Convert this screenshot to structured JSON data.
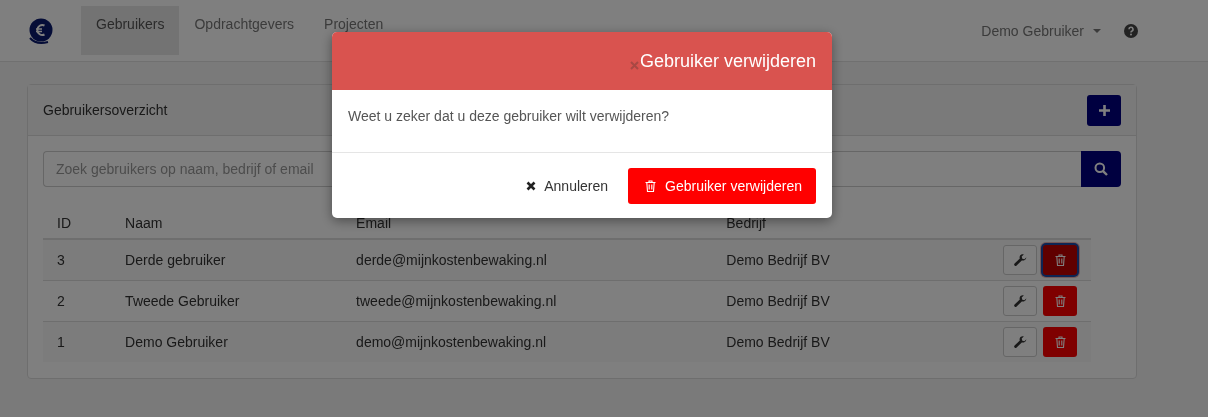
{
  "navbar": {
    "items": [
      {
        "label": "Gebruikers",
        "selected": true
      },
      {
        "label": "Opdrachtgevers",
        "selected": false
      },
      {
        "label": "Projecten",
        "selected": false
      }
    ],
    "user_menu": "Demo Gebruiker"
  },
  "panel": {
    "title": "Gebruikersoverzicht",
    "search": {
      "placeholder": "Zoek gebruikers op naam, bedrijf of email"
    },
    "table": {
      "columns": [
        "ID",
        "Naam",
        "Email",
        "Bedrijf"
      ],
      "rows": [
        {
          "id": "3",
          "name": "Derde gebruiker",
          "email": "derde@mijnkostenbewaking.nl",
          "company": "Demo Bedrijf BV",
          "delete_focused": true
        },
        {
          "id": "2",
          "name": "Tweede Gebruiker",
          "email": "tweede@mijnkostenbewaking.nl",
          "company": "Demo Bedrijf BV",
          "delete_focused": false
        },
        {
          "id": "1",
          "name": "Demo Gebruiker",
          "email": "demo@mijnkostenbewaking.nl",
          "company": "Demo Bedrijf BV",
          "delete_focused": false
        }
      ]
    }
  },
  "modal": {
    "title": "Gebruiker verwijderen",
    "message": "Weet u zeker dat u deze gebruiker wilt verwijderen?",
    "buttons": [
      {
        "label": "Annuleren",
        "kind": "cancel"
      },
      {
        "label": "Gebruiker verwijderen",
        "kind": "danger"
      }
    ]
  }
}
